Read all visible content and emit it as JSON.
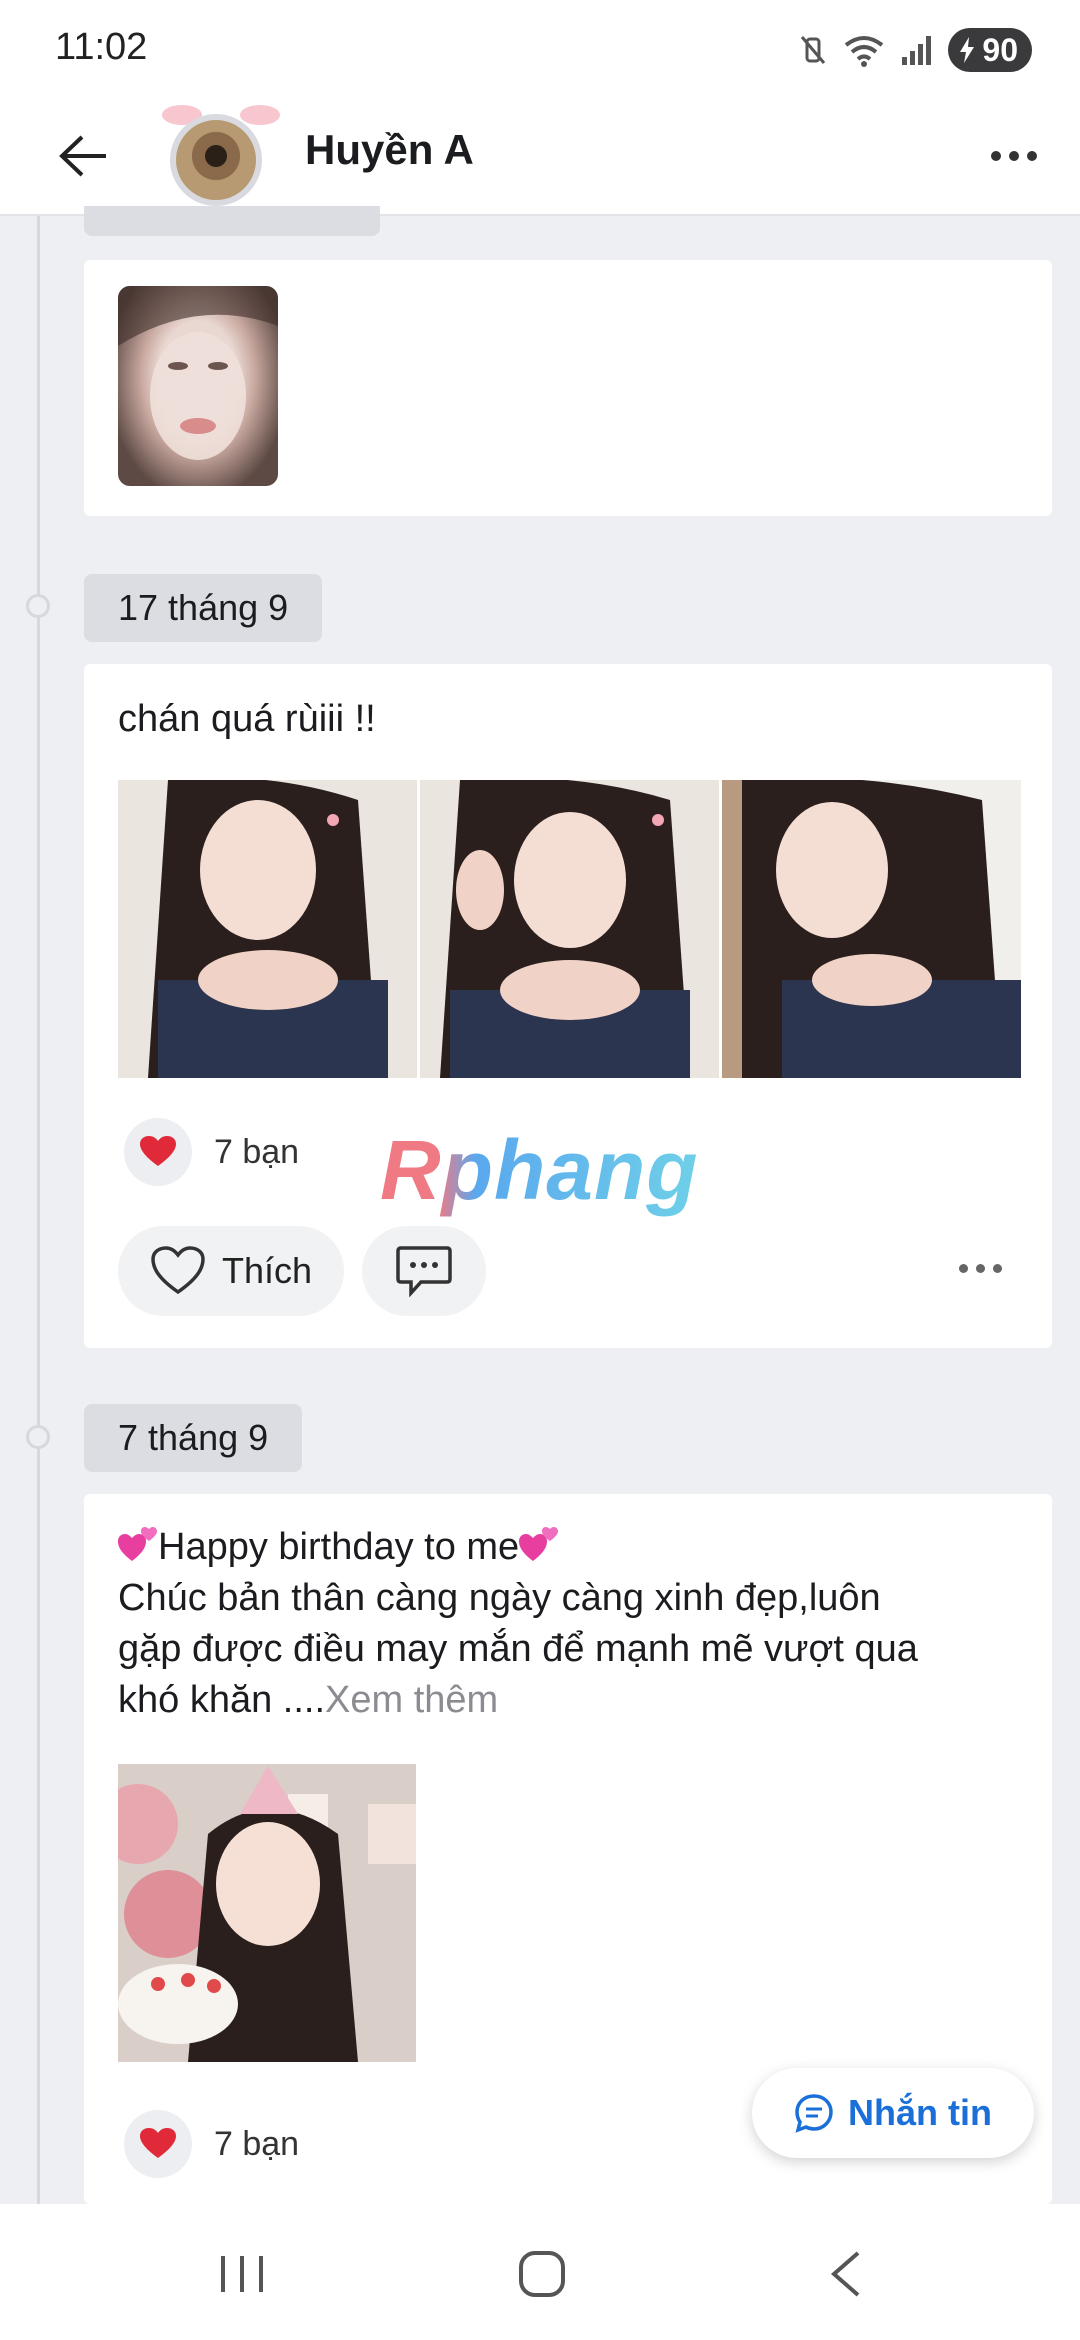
{
  "status_bar": {
    "time": "11:02",
    "battery": "90"
  },
  "header": {
    "name": "Huyền A"
  },
  "posts": [
    {
      "id": "post-top-partial",
      "photos": [
        "selfie-closeup"
      ]
    },
    {
      "date": "17 tháng 9",
      "text": "chán quá rùiii !!",
      "photos": [
        "selfie-1",
        "selfie-2",
        "selfie-3"
      ],
      "likes": "7 bạn",
      "like_label": "Thích"
    },
    {
      "date": "7 tháng 9",
      "text_line1": "Happy birthday to me",
      "text_line2": "Chúc bản thân càng ngày càng xinh đẹp,luôn",
      "text_line3": "gặp được điều may mắn để mạnh mẽ vượt qua",
      "text_line4": "khó khăn ....",
      "see_more": "Xem thêm",
      "photos": [
        "birthday-photo"
      ],
      "likes": "7 bạn"
    }
  ],
  "watermark": "Rphang",
  "message_button": "Nhắn tin",
  "colors": {
    "accent": "#1a6fd8",
    "heart": "#e02a3a",
    "background": "#eeeff3"
  }
}
